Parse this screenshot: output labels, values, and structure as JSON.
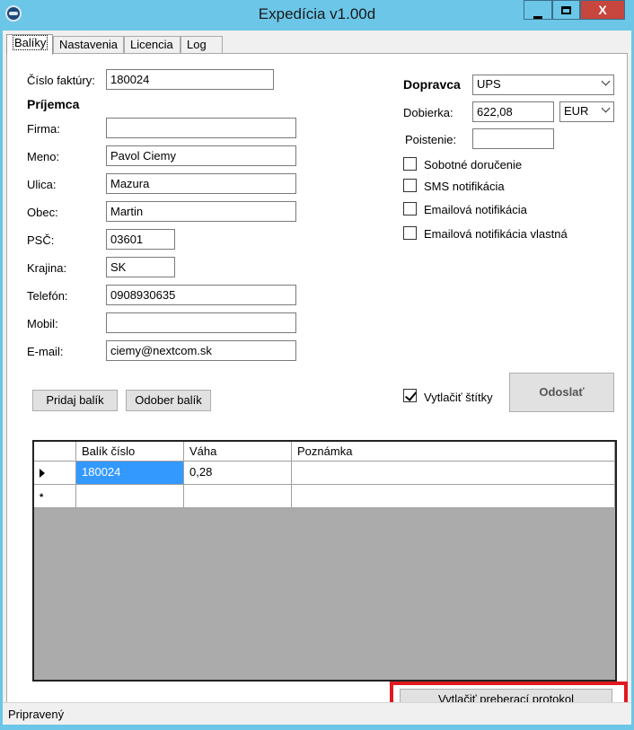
{
  "window": {
    "title": "Expedícia v1.00d",
    "minimize_icon": "minimize-icon",
    "maximize_icon": "maximize-icon",
    "close_label": "X",
    "app_icon": "app-icon"
  },
  "tabs": [
    {
      "label": "Balíky",
      "active": true
    },
    {
      "label": "Nastavenia",
      "active": false
    },
    {
      "label": "Licencia",
      "active": false
    },
    {
      "label": "Log",
      "active": false
    }
  ],
  "form": {
    "invoice_label": "Číslo faktúry:",
    "invoice_value": "180024",
    "recipient_heading": "Príjemca",
    "firma_label": "Firma:",
    "firma_value": "",
    "meno_label": "Meno:",
    "meno_value": "Pavol Ciemy",
    "ulica_label": "Ulica:",
    "ulica_value": "Mazura",
    "obec_label": "Obec:",
    "obec_value": "Martin",
    "psc_label": "PSČ:",
    "psc_value": "03601",
    "krajina_label": "Krajina:",
    "krajina_value": "SK",
    "telefon_label": "Telefón:",
    "telefon_value": "0908930635",
    "mobil_label": "Mobil:",
    "mobil_value": "",
    "email_label": "E-mail:",
    "email_value": "ciemy@nextcom.sk"
  },
  "shipping": {
    "carrier_label": "Dopravca",
    "carrier_value": "UPS",
    "cod_label": "Dobierka:",
    "cod_value": "622,08",
    "currency_value": "EUR",
    "insurance_label": "Poistenie:",
    "insurance_value": "",
    "options": [
      {
        "label": "Sobotné doručenie",
        "checked": false
      },
      {
        "label": "SMS notifikácia",
        "checked": false
      },
      {
        "label": "Emailová notifikácia",
        "checked": false
      },
      {
        "label": "Emailová notifikácia vlastná",
        "checked": false
      }
    ],
    "print_labels_label": "Vytlačiť štítky",
    "print_labels_checked": true,
    "send_label": "Odoslať"
  },
  "buttons": {
    "add_package": "Pridaj balík",
    "remove_package": "Odober balík",
    "print_protocol": "Vytlačiť preberací protokol"
  },
  "grid": {
    "columns": [
      "Balík číslo",
      "Váha",
      "Poznámka"
    ],
    "rows": [
      {
        "cislo": "180024",
        "vaha": "0,28",
        "poznamka": ""
      }
    ],
    "new_row_marker": "*"
  },
  "status": {
    "text": "Pripravený"
  },
  "colors": {
    "titlebar": "#6cc6e8",
    "close_button": "#c7463e",
    "selection": "#3399ff",
    "highlight_box": "#e0191f"
  }
}
